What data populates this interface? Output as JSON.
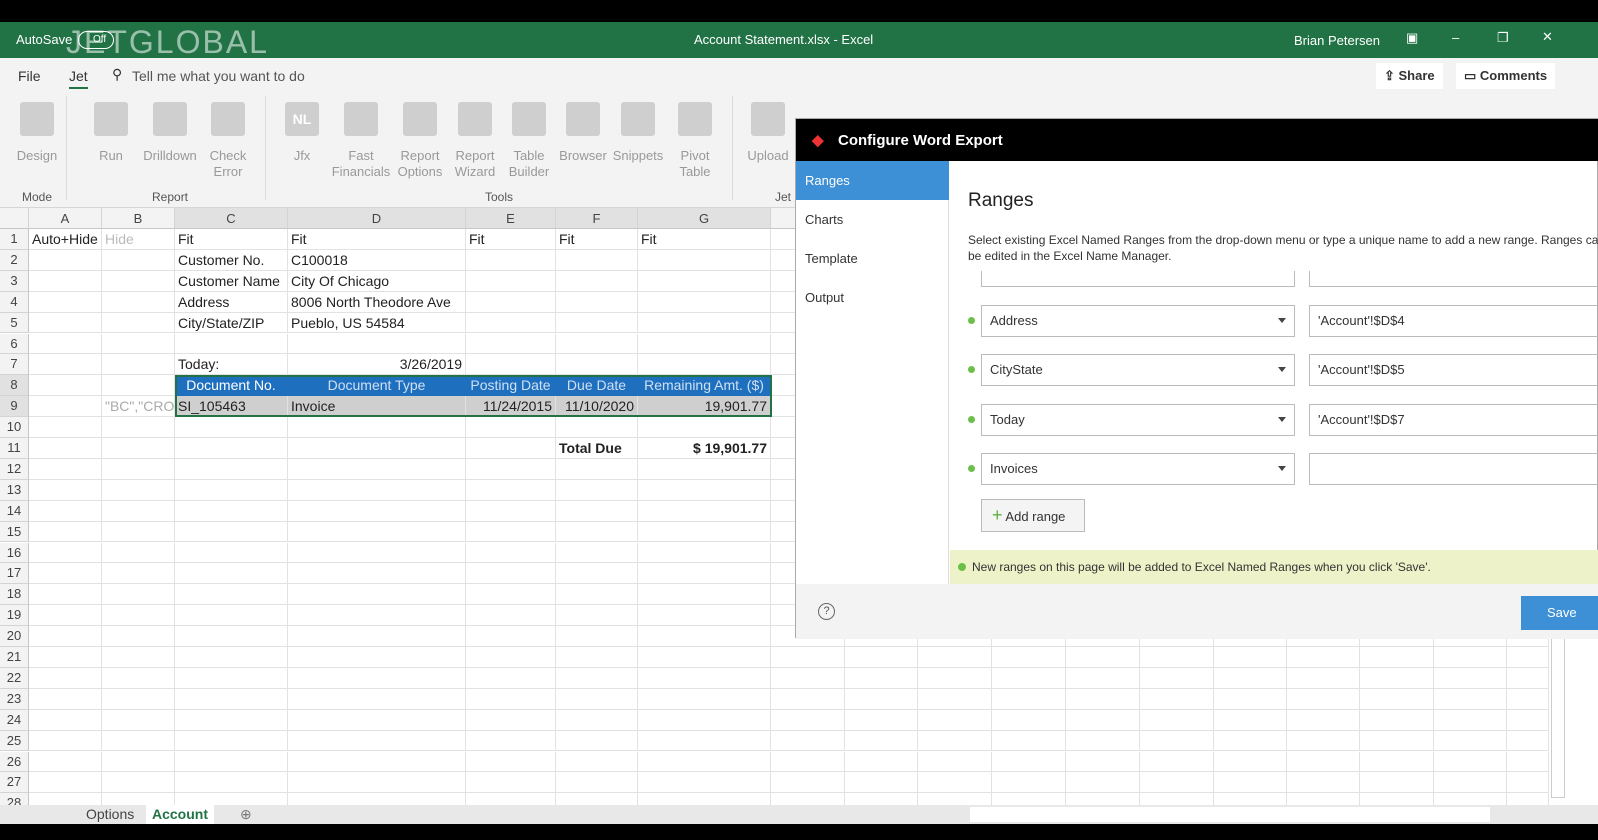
{
  "titlebar": {
    "autosave": "AutoSave",
    "autosave_state": "Off",
    "logo": "JETGLOBAL",
    "title": "Account Statement.xlsx  -  Excel",
    "user": "Brian Petersen"
  },
  "menu": {
    "file": "File",
    "jet": "Jet",
    "search_placeholder": "Tell me what you want to do",
    "share": "Share",
    "comments": "Comments"
  },
  "ribbon": {
    "buttons": [
      {
        "label": "Design",
        "icon": "design-icon"
      },
      {
        "label": "Run",
        "icon": "run-icon"
      },
      {
        "label": "Drilldown",
        "icon": "drilldown-icon"
      },
      {
        "label": "Check Error",
        "icon": "check-error-icon"
      },
      {
        "label": "Jfx",
        "icon": "nl-icon"
      },
      {
        "label": "Fast Financials",
        "icon": "fast-financials-icon"
      },
      {
        "label": "Report Options",
        "icon": "report-options-icon"
      },
      {
        "label": "Report Wizard",
        "icon": "report-wizard-icon"
      },
      {
        "label": "Table Builder",
        "icon": "table-builder-icon"
      },
      {
        "label": "Browser",
        "icon": "browser-icon"
      },
      {
        "label": "Snippets",
        "icon": "snippets-icon"
      },
      {
        "label": "Pivot Table",
        "icon": "pivot-table-icon"
      },
      {
        "label": "Upload",
        "icon": "upload-icon"
      }
    ],
    "groups": [
      "Mode",
      "Report",
      "Tools",
      "Jet"
    ]
  },
  "sheet": {
    "columns": [
      "A",
      "B",
      "C",
      "D",
      "E",
      "F",
      "G"
    ],
    "rows": [
      [
        "Auto+Hide",
        "Hide",
        "Fit",
        "Fit",
        "Fit",
        "Fit",
        "Fit"
      ],
      [
        "",
        "",
        "Customer No.",
        "C100018",
        "",
        "",
        ""
      ],
      [
        "",
        "",
        "Customer Name",
        "City Of Chicago",
        "",
        "",
        ""
      ],
      [
        "",
        "",
        "Address",
        "8006 North Theodore Ave",
        "",
        "",
        ""
      ],
      [
        "",
        "",
        "City/State/ZIP",
        "Pueblo, US 54584",
        "",
        "",
        ""
      ],
      [
        "",
        "",
        "",
        "",
        "",
        "",
        ""
      ],
      [
        "",
        "",
        "Today:",
        "3/26/2019",
        "",
        "",
        ""
      ],
      [
        "",
        "",
        "Document No.",
        "Document Type",
        "Posting Date",
        "Due Date",
        "Remaining Amt. ($)"
      ],
      [
        "",
        "\"BC\",\"CRO",
        "SI_105463",
        "Invoice",
        "11/24/2015",
        "11/10/2020",
        "19,901.77"
      ],
      [
        "",
        "",
        "",
        "",
        "",
        "",
        ""
      ],
      [
        "",
        "",
        "",
        "",
        "",
        "Total Due",
        "$         19,901.77"
      ]
    ],
    "row_count": 28,
    "tabs": [
      "Options",
      "Account"
    ],
    "active_tab": "Account"
  },
  "dialog": {
    "title": "Configure Word Export",
    "nav": [
      "Ranges",
      "Charts",
      "Template",
      "Output"
    ],
    "active_nav": "Ranges",
    "heading": "Ranges",
    "description": "Select existing Excel Named Ranges from the drop-down menu or type a unique name to add a new range. Ranges can be edited in the Excel Name Manager.",
    "ranges": [
      {
        "name": "Address",
        "ref": "'Account'!$D$4"
      },
      {
        "name": "CityState",
        "ref": "'Account'!$D$5"
      },
      {
        "name": "Today",
        "ref": "'Account'!$D$7"
      },
      {
        "name": "Invoices",
        "ref": ""
      }
    ],
    "add_range": "Add range",
    "notice": "New ranges on this page will be added to Excel Named Ranges when you click 'Save'.",
    "save": "Save"
  },
  "colors": {
    "excel_green": "#217346",
    "dialog_accent": "#3d8fd6",
    "table_header": "#1f6fbf",
    "notice_bg": "#eef2c8",
    "status_dot": "#6cc04a"
  }
}
